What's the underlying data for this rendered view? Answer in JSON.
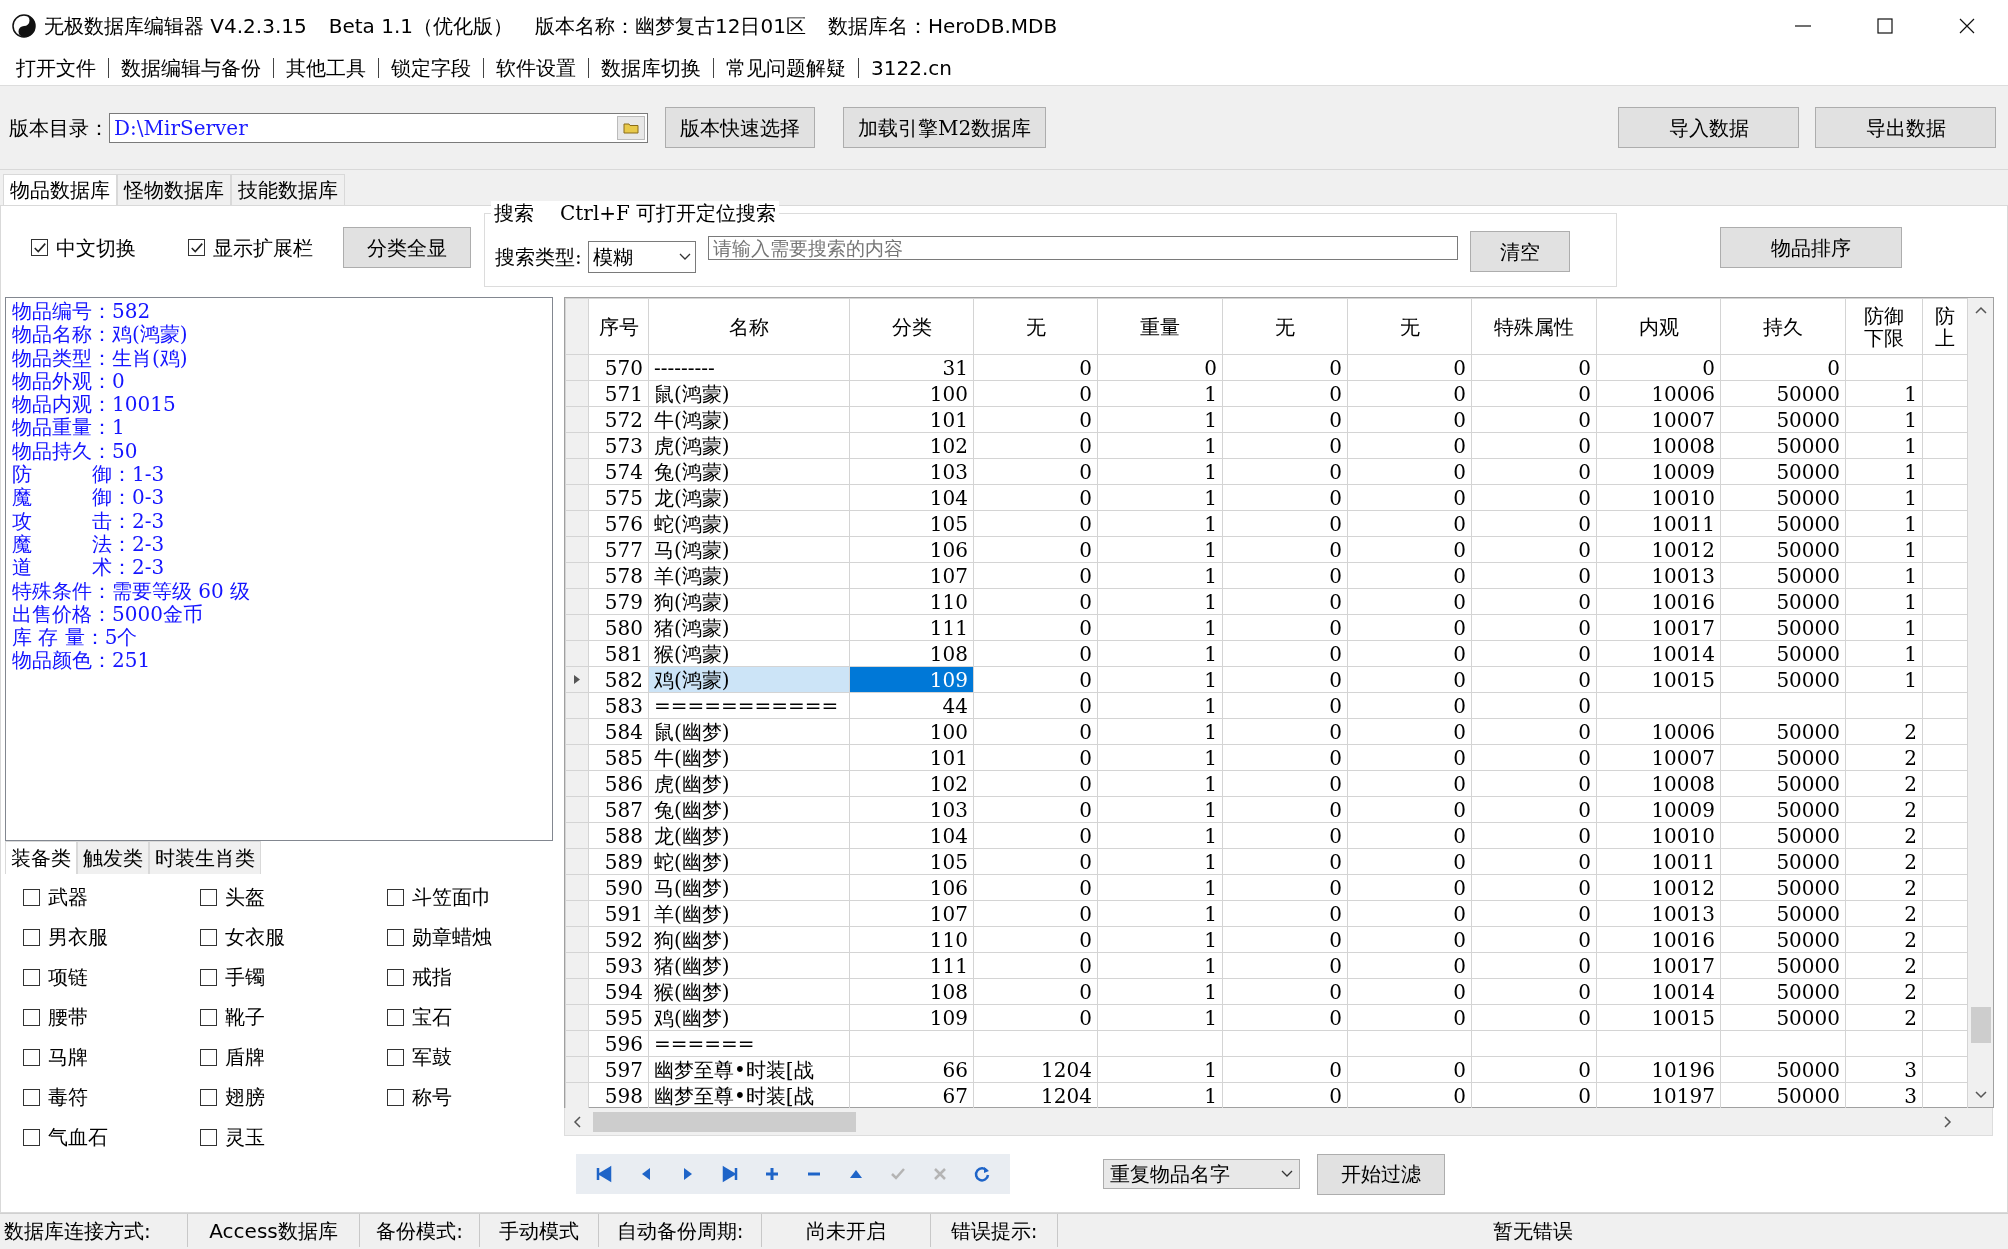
{
  "window": {
    "title": "无极数据库编辑器 V4.2.3.15",
    "edition": "Beta 1.1（优化版）",
    "version_name": "版本名称：幽梦复古12日01区",
    "database_name": "数据库名：HeroDB.MDB"
  },
  "menu": [
    "打开文件",
    "数据编辑与备份",
    "其他工具",
    "锁定字段",
    "软件设置",
    "数据库切换",
    "常见问题解疑",
    "3122.cn"
  ],
  "toolbar": {
    "directory_label": "版本目录：",
    "directory": "D:\\MirServer",
    "buttons_left": [
      "版本快速选择",
      "加载引擎M2数据库"
    ],
    "buttons_right": [
      "导入数据",
      "导出数据"
    ]
  },
  "tabs": [
    {
      "label": "物品数据库",
      "selected": true
    },
    {
      "label": "怪物数据库",
      "selected": false
    },
    {
      "label": "技能数据库",
      "selected": false
    }
  ],
  "filters": {
    "checkboxes": [
      {
        "label": "中文切换",
        "checked": true
      },
      {
        "label": "显示扩展栏",
        "checked": true
      }
    ],
    "show_all_button": "分类全显",
    "search": {
      "title": "搜索",
      "hint": "Ctrl+F 可打开定位搜索",
      "type_label": "搜索类型:",
      "type_value": "模糊",
      "placeholder": "请输入需要搜索的内容",
      "clear_button": "清空"
    },
    "sort_button": "物品排序"
  },
  "item_info": [
    "物品编号：582",
    "物品名称：鸡(鸿蒙)",
    "物品类型：生肖(鸡)",
    "物品外观：0",
    "物品内观：10015",
    "物品重量：1",
    "物品持久：50",
    "防　　　御：1-3",
    "魔　　　御：0-3",
    "攻　　　击：2-3",
    "魔　　　法：2-3",
    "道　　　术：2-3",
    "特殊条件：需要等级 60 级",
    "出售价格：5000金币",
    "库 存 量：5个",
    "物品颜色：251"
  ],
  "categories": {
    "tabs": [
      {
        "label": "装备类",
        "selected": true
      },
      {
        "label": "触发类",
        "selected": false
      },
      {
        "label": "时装生肖类",
        "selected": false
      }
    ],
    "items": [
      {
        "label": "武器",
        "checked": false
      },
      {
        "label": "头盔",
        "checked": false
      },
      {
        "label": "斗笠面巾",
        "checked": false
      },
      {
        "label": "男衣服",
        "checked": false
      },
      {
        "label": "女衣服",
        "checked": false
      },
      {
        "label": "勋章蜡烛",
        "checked": false
      },
      {
        "label": "项链",
        "checked": false
      },
      {
        "label": "手镯",
        "checked": false
      },
      {
        "label": "戒指",
        "checked": false
      },
      {
        "label": "腰带",
        "checked": false
      },
      {
        "label": "靴子",
        "checked": false
      },
      {
        "label": "宝石",
        "checked": false
      },
      {
        "label": "马牌",
        "checked": false
      },
      {
        "label": "盾牌",
        "checked": false
      },
      {
        "label": "军鼓",
        "checked": false
      },
      {
        "label": "毒符",
        "checked": false
      },
      {
        "label": "翅膀",
        "checked": false
      },
      {
        "label": "称号",
        "checked": false
      },
      {
        "label": "气血石",
        "checked": false
      },
      {
        "label": "灵玉",
        "checked": false
      }
    ]
  },
  "table": {
    "columns": [
      "序号",
      "名称",
      "分类",
      "无",
      "重量",
      "无",
      "无",
      "特殊属性",
      "内观",
      "持久",
      "防御下限",
      "防上"
    ],
    "rows": [
      {
        "selected": false,
        "cells": [
          "570",
          "---------",
          "31",
          "0",
          "0",
          "0",
          "0",
          "0",
          "0",
          "0"
        ]
      },
      {
        "selected": false,
        "cells": [
          "571",
          "鼠(鸿蒙)",
          "100",
          "0",
          "1",
          "0",
          "0",
          "0",
          "10006",
          "50000",
          "1"
        ]
      },
      {
        "selected": false,
        "cells": [
          "572",
          "牛(鸿蒙)",
          "101",
          "0",
          "1",
          "0",
          "0",
          "0",
          "10007",
          "50000",
          "1"
        ]
      },
      {
        "selected": false,
        "cells": [
          "573",
          "虎(鸿蒙)",
          "102",
          "0",
          "1",
          "0",
          "0",
          "0",
          "10008",
          "50000",
          "1"
        ]
      },
      {
        "selected": false,
        "cells": [
          "574",
          "兔(鸿蒙)",
          "103",
          "0",
          "1",
          "0",
          "0",
          "0",
          "10009",
          "50000",
          "1"
        ]
      },
      {
        "selected": false,
        "cells": [
          "575",
          "龙(鸿蒙)",
          "104",
          "0",
          "1",
          "0",
          "0",
          "0",
          "10010",
          "50000",
          "1"
        ]
      },
      {
        "selected": false,
        "cells": [
          "576",
          "蛇(鸿蒙)",
          "105",
          "0",
          "1",
          "0",
          "0",
          "0",
          "10011",
          "50000",
          "1"
        ]
      },
      {
        "selected": false,
        "cells": [
          "577",
          "马(鸿蒙)",
          "106",
          "0",
          "1",
          "0",
          "0",
          "0",
          "10012",
          "50000",
          "1"
        ]
      },
      {
        "selected": false,
        "cells": [
          "578",
          "羊(鸿蒙)",
          "107",
          "0",
          "1",
          "0",
          "0",
          "0",
          "10013",
          "50000",
          "1"
        ]
      },
      {
        "selected": false,
        "cells": [
          "579",
          "狗(鸿蒙)",
          "110",
          "0",
          "1",
          "0",
          "0",
          "0",
          "10016",
          "50000",
          "1"
        ]
      },
      {
        "selected": false,
        "cells": [
          "580",
          "猪(鸿蒙)",
          "111",
          "0",
          "1",
          "0",
          "0",
          "0",
          "10017",
          "50000",
          "1"
        ]
      },
      {
        "selected": false,
        "cells": [
          "581",
          "猴(鸿蒙)",
          "108",
          "0",
          "1",
          "0",
          "0",
          "0",
          "10014",
          "50000",
          "1"
        ]
      },
      {
        "selected": true,
        "cells": [
          "582",
          "鸡(鸿蒙)",
          "109",
          "0",
          "1",
          "0",
          "0",
          "0",
          "10015",
          "50000",
          "1"
        ]
      },
      {
        "selected": false,
        "cells": [
          "583",
          "===========",
          "44",
          "0",
          "1",
          "0",
          "0",
          "0"
        ]
      },
      {
        "selected": false,
        "cells": [
          "584",
          "鼠(幽梦)",
          "100",
          "0",
          "1",
          "0",
          "0",
          "0",
          "10006",
          "50000",
          "2"
        ]
      },
      {
        "selected": false,
        "cells": [
          "585",
          "牛(幽梦)",
          "101",
          "0",
          "1",
          "0",
          "0",
          "0",
          "10007",
          "50000",
          "2"
        ]
      },
      {
        "selected": false,
        "cells": [
          "586",
          "虎(幽梦)",
          "102",
          "0",
          "1",
          "0",
          "0",
          "0",
          "10008",
          "50000",
          "2"
        ]
      },
      {
        "selected": false,
        "cells": [
          "587",
          "兔(幽梦)",
          "103",
          "0",
          "1",
          "0",
          "0",
          "0",
          "10009",
          "50000",
          "2"
        ]
      },
      {
        "selected": false,
        "cells": [
          "588",
          "龙(幽梦)",
          "104",
          "0",
          "1",
          "0",
          "0",
          "0",
          "10010",
          "50000",
          "2"
        ]
      },
      {
        "selected": false,
        "cells": [
          "589",
          "蛇(幽梦)",
          "105",
          "0",
          "1",
          "0",
          "0",
          "0",
          "10011",
          "50000",
          "2"
        ]
      },
      {
        "selected": false,
        "cells": [
          "590",
          "马(幽梦)",
          "106",
          "0",
          "1",
          "0",
          "0",
          "0",
          "10012",
          "50000",
          "2"
        ]
      },
      {
        "selected": false,
        "cells": [
          "591",
          "羊(幽梦)",
          "107",
          "0",
          "1",
          "0",
          "0",
          "0",
          "10013",
          "50000",
          "2"
        ]
      },
      {
        "selected": false,
        "cells": [
          "592",
          "狗(幽梦)",
          "110",
          "0",
          "1",
          "0",
          "0",
          "0",
          "10016",
          "50000",
          "2"
        ]
      },
      {
        "selected": false,
        "cells": [
          "593",
          "猪(幽梦)",
          "111",
          "0",
          "1",
          "0",
          "0",
          "0",
          "10017",
          "50000",
          "2"
        ]
      },
      {
        "selected": false,
        "cells": [
          "594",
          "猴(幽梦)",
          "108",
          "0",
          "1",
          "0",
          "0",
          "0",
          "10014",
          "50000",
          "2"
        ]
      },
      {
        "selected": false,
        "cells": [
          "595",
          "鸡(幽梦)",
          "109",
          "0",
          "1",
          "0",
          "0",
          "0",
          "10015",
          "50000",
          "2"
        ]
      },
      {
        "selected": false,
        "cells": [
          "596",
          "======"
        ]
      },
      {
        "selected": false,
        "cells": [
          "597",
          "幽梦至尊•时装[战",
          "66",
          "1204",
          "1",
          "0",
          "0",
          "0",
          "10196",
          "50000",
          "3"
        ]
      },
      {
        "selected": false,
        "cells": [
          "598",
          "幽梦至尊•时装[战",
          "67",
          "1204",
          "1",
          "0",
          "0",
          "0",
          "10197",
          "50000",
          "3"
        ]
      }
    ]
  },
  "navigator": [
    {
      "kind": "first",
      "disabled": false
    },
    {
      "kind": "prior",
      "disabled": false
    },
    {
      "kind": "next",
      "disabled": false
    },
    {
      "kind": "last",
      "disabled": false
    },
    {
      "kind": "insert",
      "disabled": false
    },
    {
      "kind": "delete",
      "disabled": false
    },
    {
      "kind": "edit",
      "disabled": false
    },
    {
      "kind": "post",
      "disabled": true
    },
    {
      "kind": "cancel",
      "disabled": true
    },
    {
      "kind": "refresh",
      "disabled": false
    }
  ],
  "filter": {
    "mode": "重复物品名字",
    "button": "开始过滤"
  },
  "status_bar": [
    "数据库连接方式:",
    "Access数据库",
    "备份模式:",
    "手动模式",
    "自动备份周期:",
    "尚未开启",
    "错误提示:",
    "暂无错误"
  ]
}
